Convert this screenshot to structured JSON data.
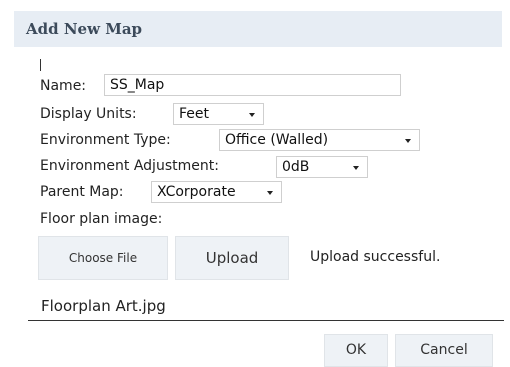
{
  "dialog": {
    "title": "Add New Map"
  },
  "form": {
    "name_label": "Name:",
    "name_value": "SS_Map",
    "display_units_label": "Display Units:",
    "display_units_value": "Feet",
    "environment_type_label": "Environment Type:",
    "environment_type_value": "Office (Walled)",
    "environment_adjustment_label": "Environment Adjustment:",
    "environment_adjustment_value": "0dB",
    "parent_map_label": "Parent Map:",
    "parent_map_value": "XCorporate",
    "floor_plan_label": "Floor plan image:"
  },
  "upload": {
    "choose_file_label": "Choose File",
    "upload_label": "Upload",
    "status_text": "Upload successful.",
    "file_name": "Floorplan Art.jpg"
  },
  "footer": {
    "ok_label": "OK",
    "cancel_label": "Cancel"
  },
  "icons": {
    "dropdown_arrow": "caret-down-icon"
  }
}
